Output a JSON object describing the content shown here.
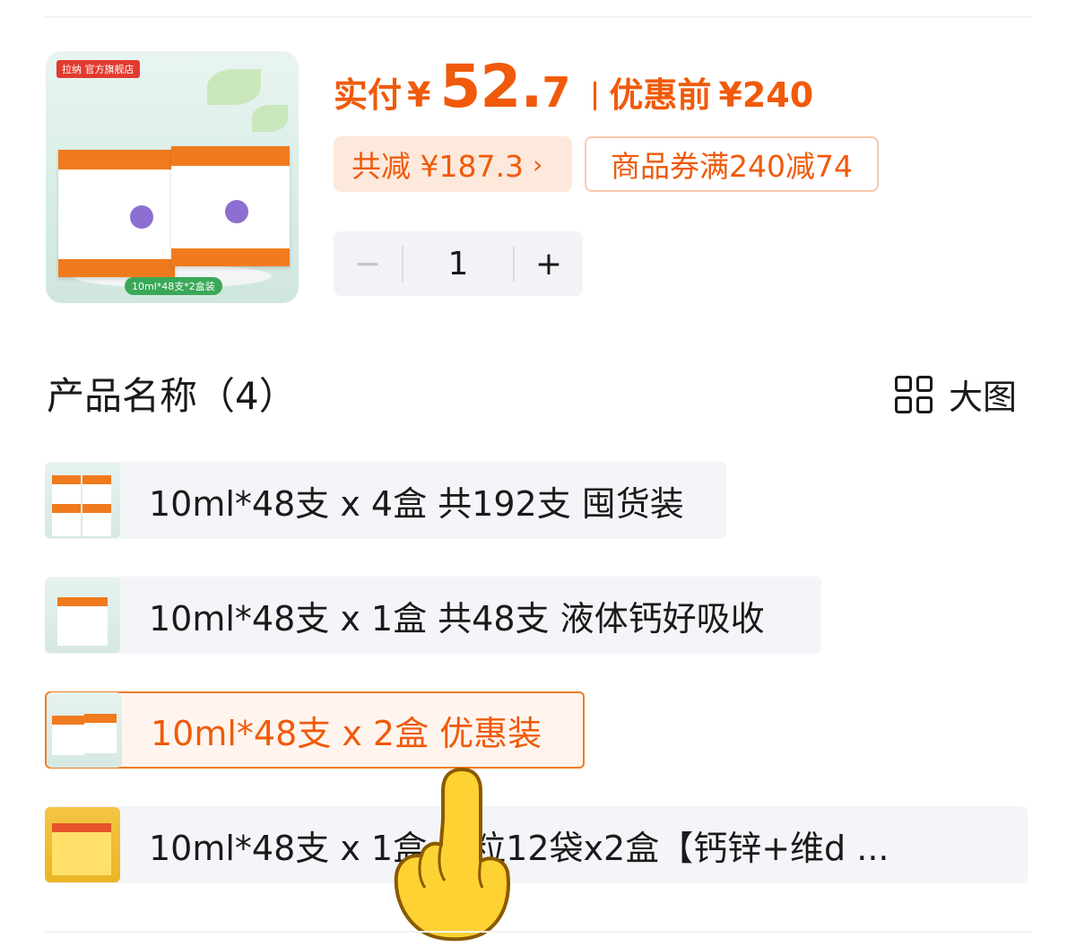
{
  "product": {
    "thumbnail_icon": "product-box-image-icon",
    "thumbnail_brand": "拉纳 官方旗舰店",
    "thumbnail_tag": "10ml*48支*2盒装"
  },
  "price": {
    "paid_label": "实付",
    "currency": "¥",
    "paid_int": "52.",
    "paid_dec": "7",
    "before_label": "优惠前",
    "before_value": "¥240"
  },
  "discount": {
    "total_label": "共减 ¥187.3",
    "arrow": "›",
    "coupon_label": "商品券满240减74"
  },
  "quantity": {
    "minus": "−",
    "value": "1",
    "plus": "+"
  },
  "section": {
    "title": "产品名称（4）",
    "bigview_label": "大图",
    "bigview_icon": "grid-icon"
  },
  "options": [
    {
      "label": "10ml*48支 x 4盒 共192支 囤货装",
      "selected": false
    },
    {
      "label": "10ml*48支 x 1盒 共48支 液体钙好吸收",
      "selected": false
    },
    {
      "label": "10ml*48支 x 2盒 优惠装",
      "selected": true
    },
    {
      "label": "10ml*48支 x 1盒      颗粒12袋x2盒【钙锌+维d ...",
      "selected": false
    }
  ],
  "colors": {
    "accent": "#f05a0a",
    "accent_light": "#fde9dc",
    "option_bg": "#f3f5f8"
  }
}
